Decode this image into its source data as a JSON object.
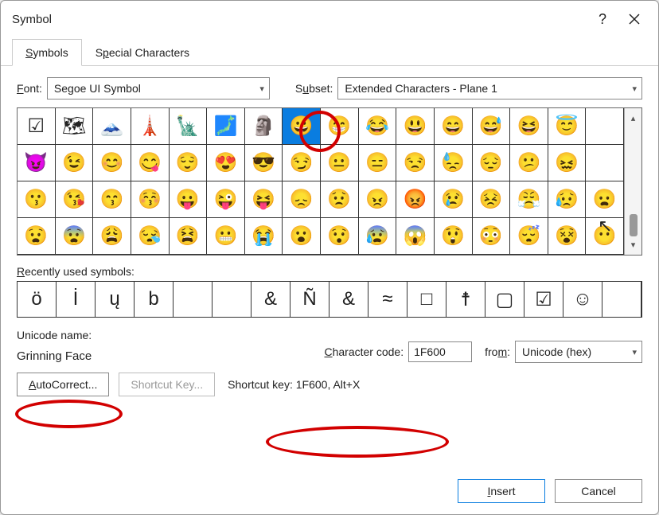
{
  "window": {
    "title": "Symbol"
  },
  "tabs": [
    {
      "label": "Symbols",
      "active": true
    },
    {
      "label": "Special Characters",
      "active": false
    }
  ],
  "font": {
    "label": "Font:",
    "value": "Segoe UI Symbol"
  },
  "subset": {
    "label": "Subset:",
    "value": "Extended Characters - Plane 1"
  },
  "grid_symbols": [
    "☑",
    "🗺",
    "🗻",
    "🗼",
    "🗽",
    "🗾",
    "🗿",
    "😀",
    "😁",
    "😂",
    "😃",
    "😄",
    "😅",
    "😆",
    "😇",
    "😈",
    "😉",
    "😊",
    "😋",
    "😌",
    "😍",
    "😎",
    "😏",
    "😐",
    "😑",
    "😒",
    "😓",
    "😔",
    "😕",
    "😖",
    "😗",
    "😘",
    "😙",
    "😚",
    "😛",
    "😜",
    "😝",
    "😞",
    "😟",
    "😠",
    "😡",
    "😢",
    "😣",
    "😤",
    "😥",
    "😦",
    "😧",
    "😨",
    "😩",
    "😪",
    "😫",
    "😬",
    "😭",
    "😮",
    "😯",
    "😰",
    "😱",
    "😲",
    "😳",
    "😴",
    "😵",
    "😶"
  ],
  "selected_index": 7,
  "recent": {
    "label": "Recently used symbols:"
  },
  "recent_symbols": [
    "ö",
    "İ",
    "ų",
    "b",
    "",
    "",
    "&",
    "Ñ",
    "&",
    "≈",
    "□",
    "☨",
    "▢",
    "☑",
    "☺",
    ""
  ],
  "unicode_name": {
    "label": "Unicode name:",
    "value": "Grinning Face"
  },
  "char_code": {
    "label": "Character code:",
    "value": "1F600"
  },
  "from": {
    "label": "from:",
    "value": "Unicode (hex)"
  },
  "buttons": {
    "autocorrect": "AutoCorrect...",
    "shortcut_key_btn": "Shortcut Key...",
    "shortcut_key_text": "Shortcut key: 1F600, Alt+X",
    "insert": "Insert",
    "cancel": "Cancel"
  }
}
